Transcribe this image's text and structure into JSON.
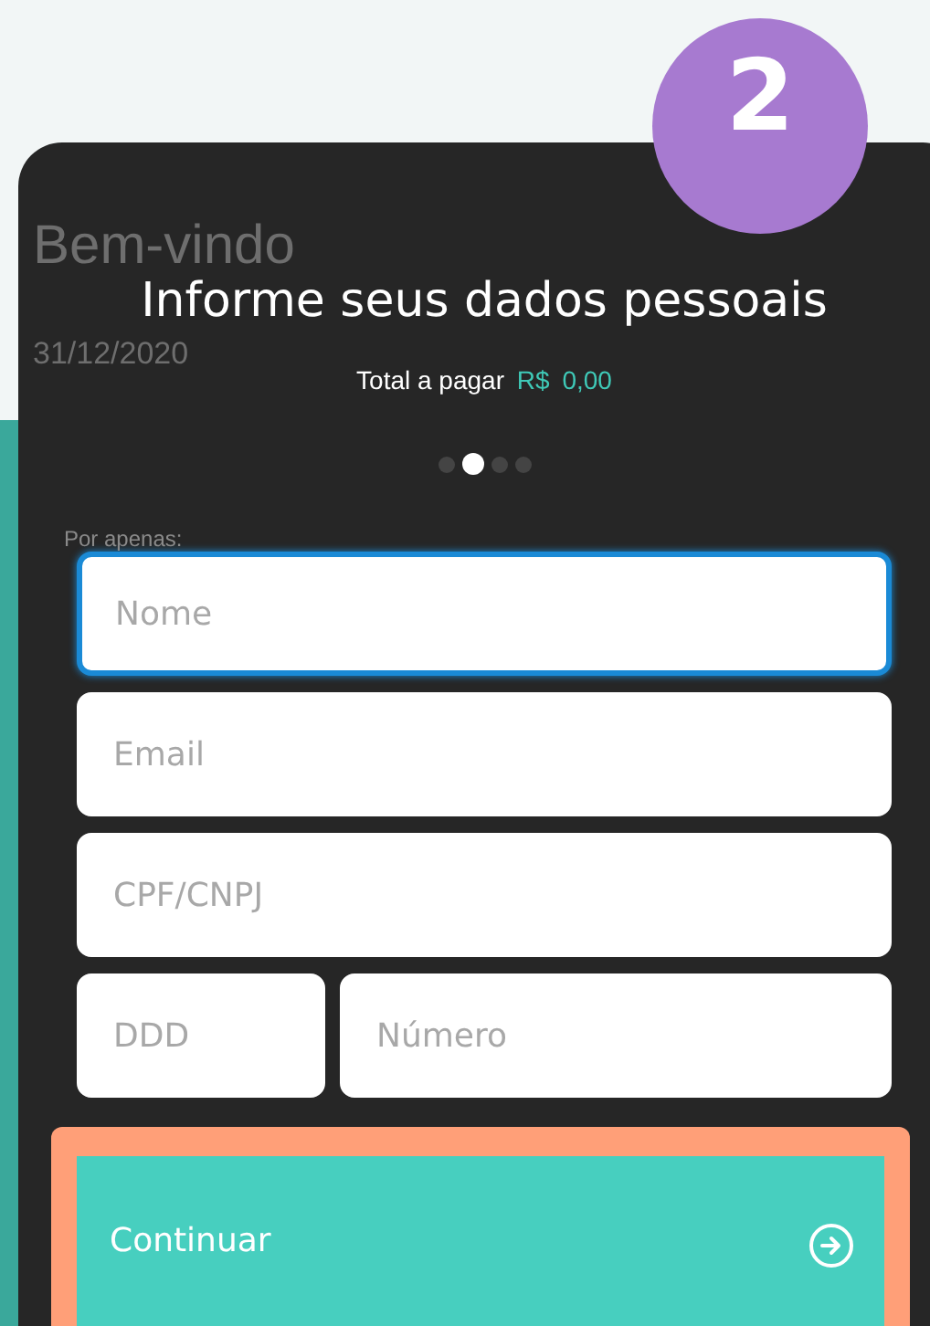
{
  "background_page": {
    "heading": "Bem-vindo",
    "date": "31/12/2020",
    "price_label": "Por apenas:"
  },
  "step_badge": "2",
  "modal": {
    "title": "Informe seus dados pessoais",
    "total": {
      "label": "Total a pagar",
      "currency": "R$",
      "amount": "0,00"
    },
    "steps": [
      {
        "selected": false
      },
      {
        "selected": true
      },
      {
        "selected": false
      },
      {
        "selected": false
      }
    ],
    "field_rows": [
      [
        {
          "placeholder": "Nome",
          "focused": true
        }
      ],
      [
        {
          "placeholder": "Email",
          "focused": false
        }
      ],
      [
        {
          "placeholder": "CPF/CNPJ",
          "focused": false
        }
      ],
      [
        {
          "placeholder": "DDD",
          "focused": false
        },
        {
          "placeholder": "Número",
          "focused": false
        }
      ]
    ],
    "button": {
      "label": "Continuar",
      "highlighted": true
    }
  }
}
